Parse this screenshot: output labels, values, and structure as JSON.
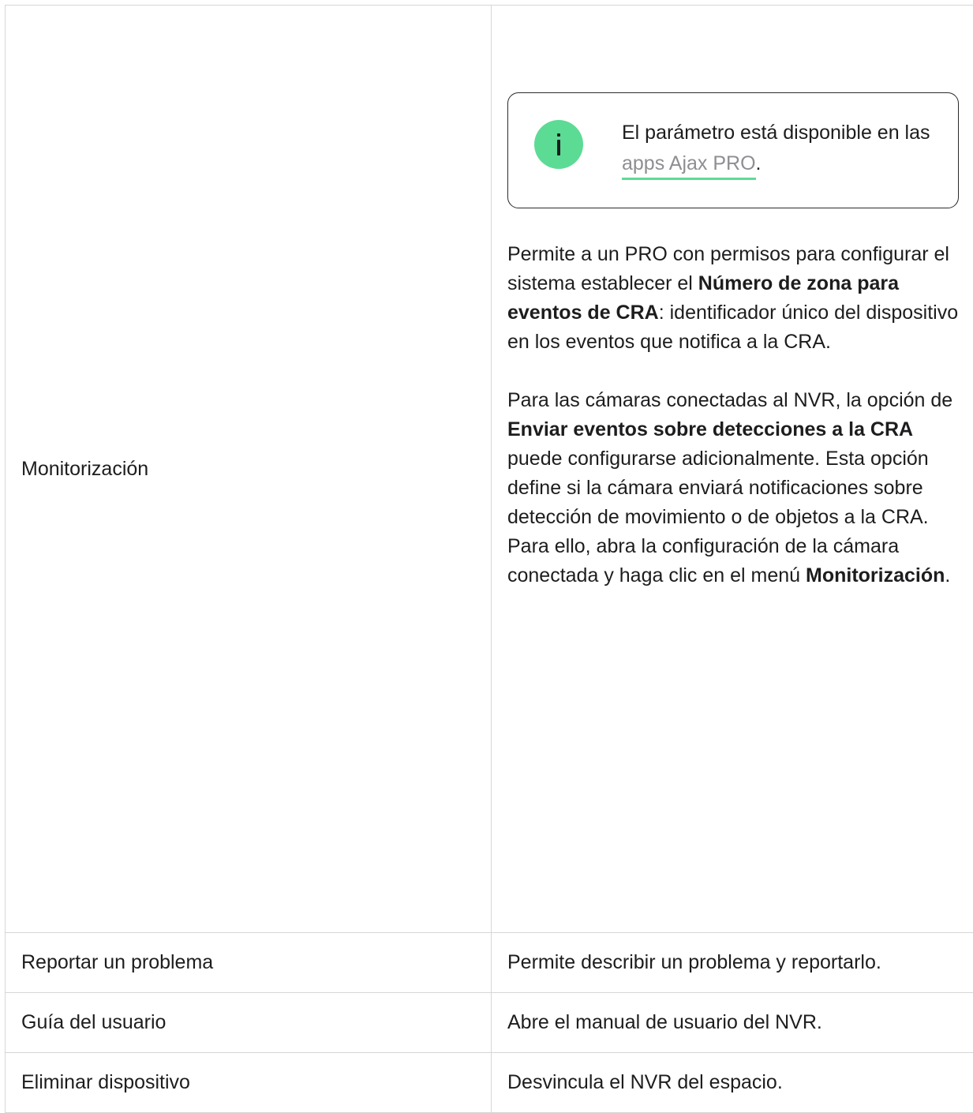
{
  "rows": [
    {
      "label": "Monitorización",
      "note": {
        "text_before": "El parámetro está disponible en las ",
        "link": "apps Ajax PRO",
        "text_after": "."
      },
      "p1": {
        "t1": "Permite a un PRO con permisos para configurar el sistema establecer el ",
        "b1": "Número de zona para eventos de CRA",
        "t2": ": identificador único del dispositivo en los eventos que notifica a la CRA."
      },
      "p2": {
        "t1": "Para las cámaras conectadas al NVR, la opción de ",
        "b1": "Enviar eventos sobre detecciones a la CRA",
        "t2": " puede configurarse adicionalmente. Esta opción define si la cámara enviará notificaciones sobre detección de movimiento o de objetos a la CRA. Para ello, abra la configuración de la cámara conectada y haga clic en el menú ",
        "b2": "Monitorización",
        "t3": "."
      }
    },
    {
      "label": "Reportar un problema",
      "desc": "Permite describir un problema y reportarlo."
    },
    {
      "label": "Guía del usuario",
      "desc": "Abre el manual de usuario del NVR."
    },
    {
      "label": "Eliminar dispositivo",
      "desc": "Desvincula el NVR del espacio."
    }
  ],
  "icons": {
    "note_icon": "info-icon",
    "note_icon_color": "#5cdb95",
    "link_underline_color": "#5cdb95"
  }
}
